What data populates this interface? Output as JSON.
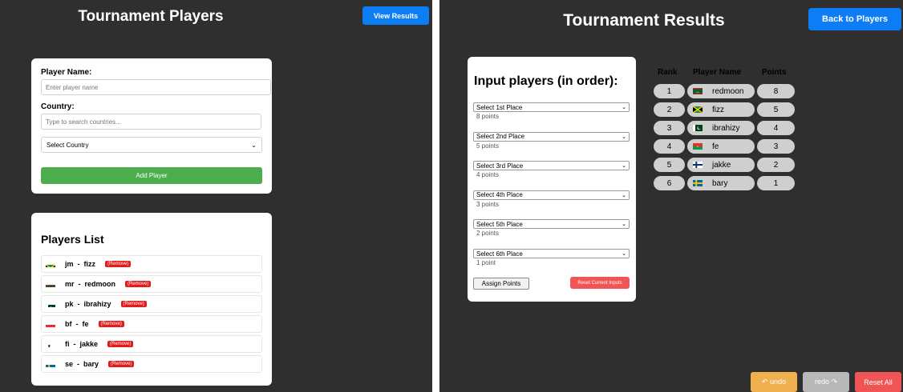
{
  "left": {
    "title": "Tournament Players",
    "view_results": "View Results",
    "form": {
      "player_name_label": "Player Name:",
      "player_name_placeholder": "Enter player name",
      "country_label": "Country:",
      "country_placeholder": "Type to search countries...",
      "country_select": "Select Country",
      "add_button": "Add Player"
    },
    "list": {
      "title": "Players List",
      "remove_label": "Remove",
      "players": [
        {
          "code": "jm",
          "name": "fizz",
          "flag": "jamaica-flag"
        },
        {
          "code": "mr",
          "name": "redmoon",
          "flag": "mauritania-flag"
        },
        {
          "code": "pk",
          "name": "ibrahizy",
          "flag": "pakistan-flag"
        },
        {
          "code": "bf",
          "name": "fe",
          "flag": "burkina-faso-flag"
        },
        {
          "code": "fi",
          "name": "jakke",
          "flag": "finland-flag"
        },
        {
          "code": "se",
          "name": "bary",
          "flag": "sweden-flag"
        }
      ]
    }
  },
  "right": {
    "title": "Tournament Results",
    "back_button": "Back to Players",
    "input_title": "Input players (in order):",
    "places": [
      {
        "label": "Select 1st Place",
        "points": "8 points"
      },
      {
        "label": "Select 2nd Place",
        "points": "5 points"
      },
      {
        "label": "Select 3rd Place",
        "points": "4 points"
      },
      {
        "label": "Select 4th Place",
        "points": "3 points"
      },
      {
        "label": "Select 5th Place",
        "points": "2 points"
      },
      {
        "label": "Select 6th Place",
        "points": "1 point"
      }
    ],
    "assign_button": "Assign Points",
    "reset_current": "Reset Current Inputs",
    "table": {
      "headers": [
        "Rank",
        "Player Name",
        "Points"
      ],
      "rows": [
        {
          "rank": "1",
          "name": "redmoon",
          "points": "8",
          "flag": "mauritania-flag"
        },
        {
          "rank": "2",
          "name": "fizz",
          "points": "5",
          "flag": "jamaica-flag"
        },
        {
          "rank": "3",
          "name": "ibrahizy",
          "points": "4",
          "flag": "pakistan-flag"
        },
        {
          "rank": "4",
          "name": "fe",
          "points": "3",
          "flag": "burkina-faso-flag"
        },
        {
          "rank": "5",
          "name": "jakke",
          "points": "2",
          "flag": "finland-flag"
        },
        {
          "rank": "6",
          "name": "bary",
          "points": "1",
          "flag": "sweden-flag"
        }
      ]
    },
    "undo": "↶ undo",
    "redo": "redo ↷",
    "reset_all": "Reset All"
  },
  "colors": {
    "background": "#2f2f2f",
    "blue": "#0d7df5",
    "green": "#4cae4f",
    "red": "#e31b1b",
    "undo": "#f0b04f",
    "redo": "#b8b8b8",
    "reset_all": "#f05454"
  }
}
